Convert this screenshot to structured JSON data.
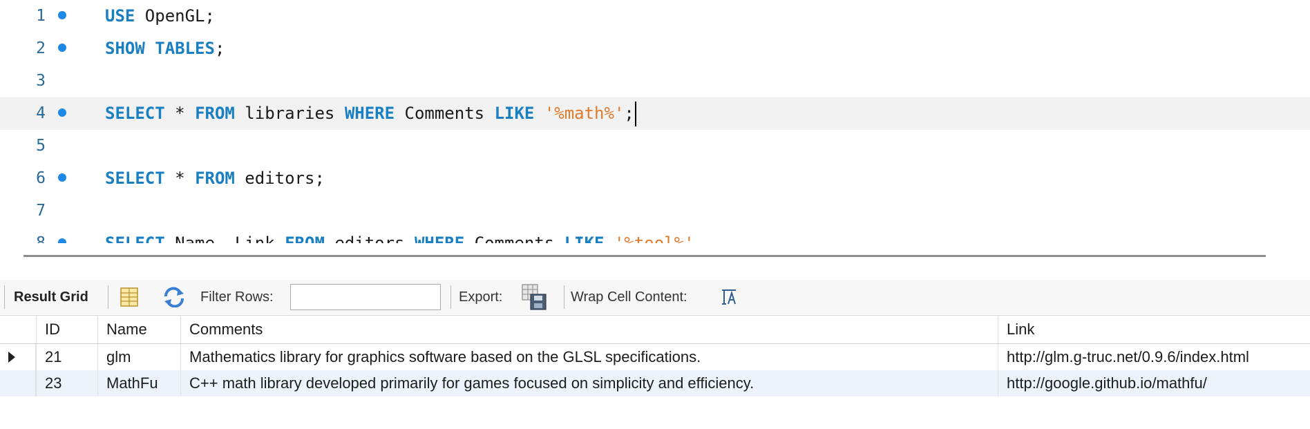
{
  "editor": {
    "lines": [
      {
        "num": "1",
        "has_dot": true
      },
      {
        "num": "2",
        "has_dot": true
      },
      {
        "num": "3",
        "has_dot": false
      },
      {
        "num": "4",
        "has_dot": true
      },
      {
        "num": "5",
        "has_dot": false
      },
      {
        "num": "6",
        "has_dot": true
      },
      {
        "num": "7",
        "has_dot": false
      },
      {
        "num": "8",
        "has_dot": true
      }
    ],
    "code": {
      "l1_kw": "USE",
      "l1_rest": " OpenGL;",
      "l2_kw": "SHOW TABLES",
      "l2_rest": ";",
      "l4_kw1": "SELECT",
      "l4_t1": " * ",
      "l4_kw2": "FROM",
      "l4_t2": " libraries ",
      "l4_kw3": "WHERE",
      "l4_t3": " Comments ",
      "l4_kw4": "LIKE",
      "l4_t4": " ",
      "l4_str": "'%math%'",
      "l4_t5": ";",
      "l6_kw1": "SELECT",
      "l6_t1": " * ",
      "l6_kw2": "FROM",
      "l6_t2": " editors;",
      "l8_kw1": "SELECT",
      "l8_t1": " Name, Link ",
      "l8_kw2": "FROM",
      "l8_t2": " editors ",
      "l8_kw3": "WHERE",
      "l8_t3": " Comments ",
      "l8_kw4": "LIKE",
      "l8_t4": " ",
      "l8_str": "'%tool%'"
    }
  },
  "toolbar": {
    "result_grid": "Result Grid",
    "filter_rows": "Filter Rows:",
    "filter_value": "",
    "export": "Export:",
    "wrap_cell": "Wrap Cell Content:"
  },
  "grid": {
    "columns": [
      "ID",
      "Name",
      "Comments",
      "Link"
    ],
    "rows": [
      {
        "id": "21",
        "name": "glm",
        "comments": "Mathematics library for graphics software based on the GLSL specifications.",
        "link": "http://glm.g-truc.net/0.9.6/index.html"
      },
      {
        "id": "23",
        "name": "MathFu",
        "comments": "C++ math library developed primarily for games focused on simplicity and efficiency.",
        "link": "http://google.github.io/mathfu/"
      }
    ]
  },
  "colors": {
    "keyword": "#1a7fc1",
    "string": "#e07a2e",
    "breakpoint_dot": "#1e88e5",
    "selected_row": "#eef3fb"
  }
}
